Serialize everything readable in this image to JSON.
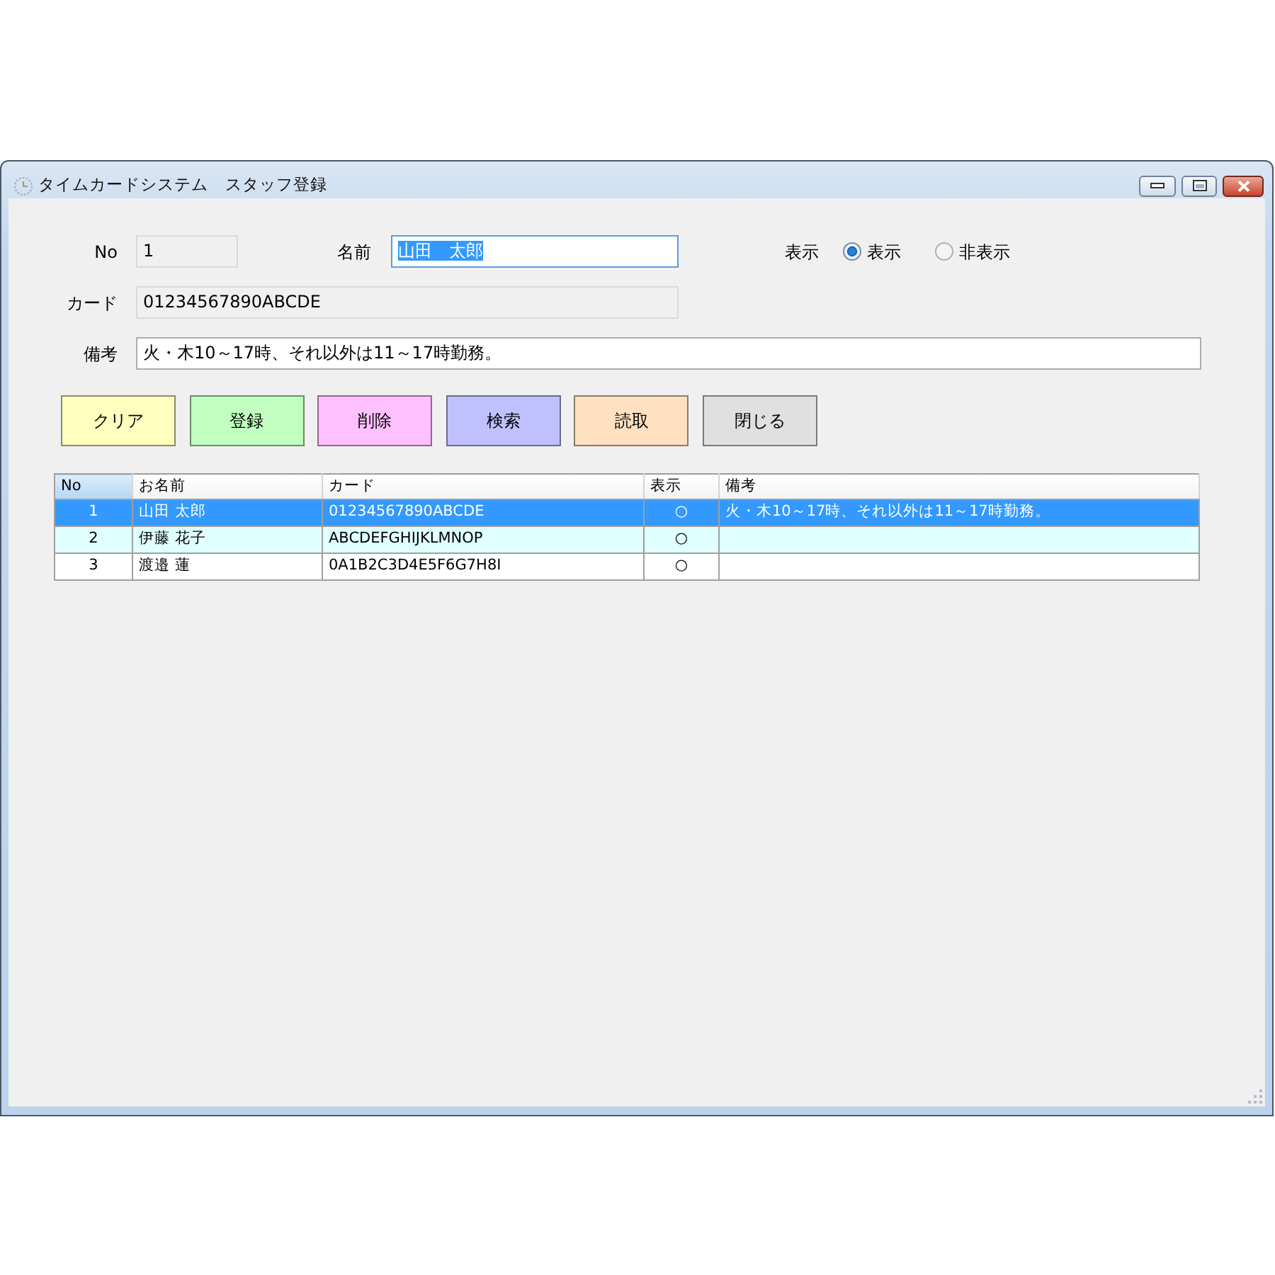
{
  "window": {
    "title": "タイムカードシステム　スタッフ登録"
  },
  "form": {
    "fields": [
      {
        "label": "No",
        "value": "1",
        "readonly": true,
        "text_selected": false
      },
      {
        "label": "名前",
        "value": "山田　太郎",
        "readonly": false,
        "text_selected": true
      },
      {
        "label": "カード",
        "value": "01234567890ABCDE",
        "readonly": true,
        "text_selected": false
      },
      {
        "label": "備考",
        "value": "火・木10～17時、それ以外は11～17時勤務。",
        "readonly": false,
        "text_selected": false
      }
    ],
    "display": {
      "label": "表示",
      "options": [
        {
          "label": "表示",
          "selected": true
        },
        {
          "label": "非表示",
          "selected": false
        }
      ]
    }
  },
  "buttons": [
    {
      "label": "クリア",
      "color": "#ffffc0"
    },
    {
      "label": "登録",
      "color": "#c0ffc0"
    },
    {
      "label": "削除",
      "color": "#ffc0ff"
    },
    {
      "label": "検索",
      "color": "#c0c0ff"
    },
    {
      "label": "読取",
      "color": "#ffe0c0"
    },
    {
      "label": "閉じる",
      "color": "#e0e0e0"
    }
  ],
  "table": {
    "columns": [
      {
        "label": "No",
        "selected": true
      },
      {
        "label": "お名前",
        "selected": false
      },
      {
        "label": "カード",
        "selected": false
      },
      {
        "label": "表示",
        "selected": false
      },
      {
        "label": "備考",
        "selected": false
      }
    ],
    "rows": [
      {
        "no": "1",
        "name": "山田 太郎",
        "card": "01234567890ABCDE",
        "display": "○",
        "remarks": "火・木10～17時、それ以外は11～17時勤務。",
        "selected": true
      },
      {
        "no": "2",
        "name": "伊藤 花子",
        "card": "ABCDEFGHIJKLMNOP",
        "display": "○",
        "selected": false
      },
      {
        "no": "3",
        "name": "渡邉 蓮",
        "card": "0A1B2C3D4E5F6G7H8I",
        "display": "○",
        "selected": false
      }
    ]
  }
}
